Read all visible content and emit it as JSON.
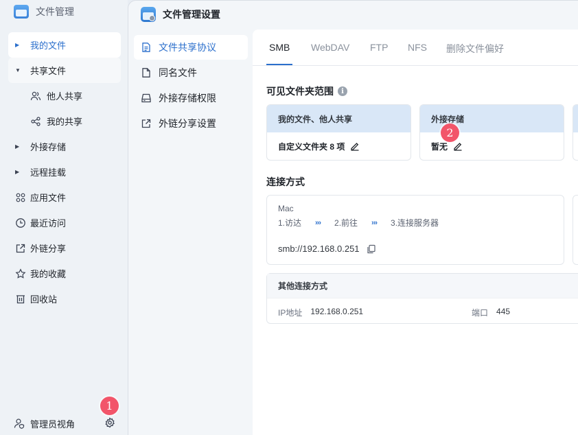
{
  "app": {
    "title": "文件管理",
    "logo_icon": "folder-app-icon"
  },
  "sidebar": {
    "items": [
      {
        "label": "我的文件",
        "icon": "caret-right-icon",
        "state": "active"
      },
      {
        "label": "共享文件",
        "icon": "caret-down-icon",
        "state": "open"
      },
      {
        "label": "他人共享",
        "icon": "users-icon",
        "state": "sub"
      },
      {
        "label": "我的共享",
        "icon": "share-icon",
        "state": "sub"
      },
      {
        "label": "外接存储",
        "icon": "caret-right-icon"
      },
      {
        "label": "远程挂载",
        "icon": "caret-right-icon"
      },
      {
        "label": "应用文件",
        "icon": "apps-grid-icon"
      },
      {
        "label": "最近访问",
        "icon": "clock-icon"
      },
      {
        "label": "外链分享",
        "icon": "external-share-icon"
      },
      {
        "label": "我的收藏",
        "icon": "star-icon"
      },
      {
        "label": "回收站",
        "icon": "trash-icon"
      }
    ],
    "footer": {
      "label": "管理员视角",
      "badge": "1"
    }
  },
  "window": {
    "title": "文件管理设置",
    "nav": [
      {
        "label": "文件共享协议",
        "icon": "document-icon",
        "active": true
      },
      {
        "label": "同名文件",
        "icon": "file-icon",
        "active": false
      },
      {
        "label": "外接存储权限",
        "icon": "drive-icon",
        "active": false
      },
      {
        "label": "外链分享设置",
        "icon": "external-share-icon",
        "active": false
      }
    ],
    "tabs": [
      "SMB",
      "WebDAV",
      "FTP",
      "NFS",
      "删除文件偏好"
    ],
    "active_tab": "SMB",
    "visible_scope": {
      "title": "可见文件夹范围",
      "cards": [
        {
          "head": "我的文件、他人共享",
          "body": "自定义文件夹 8 项"
        },
        {
          "head": "外接存储",
          "body": "暂无",
          "badge": "2"
        }
      ]
    },
    "connection": {
      "title": "连接方式",
      "mac": {
        "name": "Mac",
        "steps": [
          "1.访达",
          "2.前往",
          "3.连接服务器"
        ],
        "step_separator": "›››",
        "url": "smb://192.168.0.251"
      },
      "other": {
        "title": "其他连接方式",
        "ip_label": "IP地址",
        "ip_value": "192.168.0.251",
        "port_label": "端口",
        "port_value": "445"
      }
    }
  },
  "colors": {
    "accent": "#2b6fcc",
    "badge": "#f2556a",
    "card_head": "#d9e7f7"
  }
}
